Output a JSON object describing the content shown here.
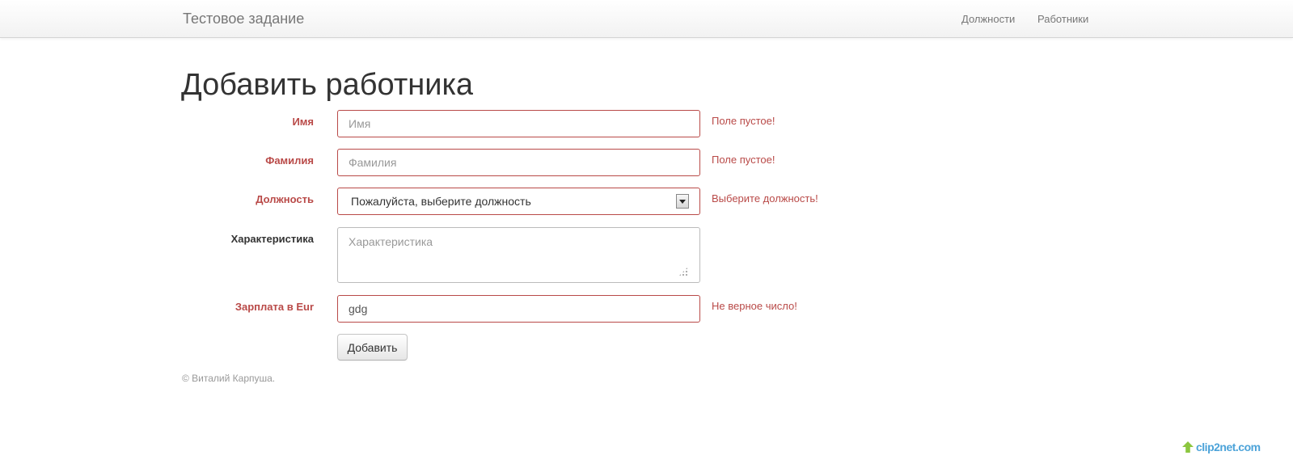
{
  "navbar": {
    "brand": "Тестовое задание",
    "links": [
      "Должности",
      "Работники"
    ]
  },
  "page": {
    "title": "Добавить работника"
  },
  "form": {
    "first_name": {
      "label": "Имя",
      "placeholder": "Имя",
      "value": "",
      "error": "Поле пустое!"
    },
    "last_name": {
      "label": "Фамилия",
      "placeholder": "Фамилия",
      "value": "",
      "error": "Поле пустое!"
    },
    "position": {
      "label": "Должность",
      "selected": "Пожалуйста, выберите должность",
      "error": "Выберите должность!"
    },
    "description": {
      "label": "Характеристика",
      "placeholder": "Характеристика",
      "value": ""
    },
    "salary": {
      "label": "Зарплата в Eur",
      "placeholder": "",
      "value": "gdg",
      "error": "Не верное число!"
    },
    "submit_label": "Добавить"
  },
  "footer": {
    "text": "© Виталий Карпуша."
  },
  "watermark": {
    "text": "clip2net.com"
  },
  "colors": {
    "error": "#b94a48",
    "navbar_text": "#777777",
    "watermark": "#4ca3d9"
  }
}
